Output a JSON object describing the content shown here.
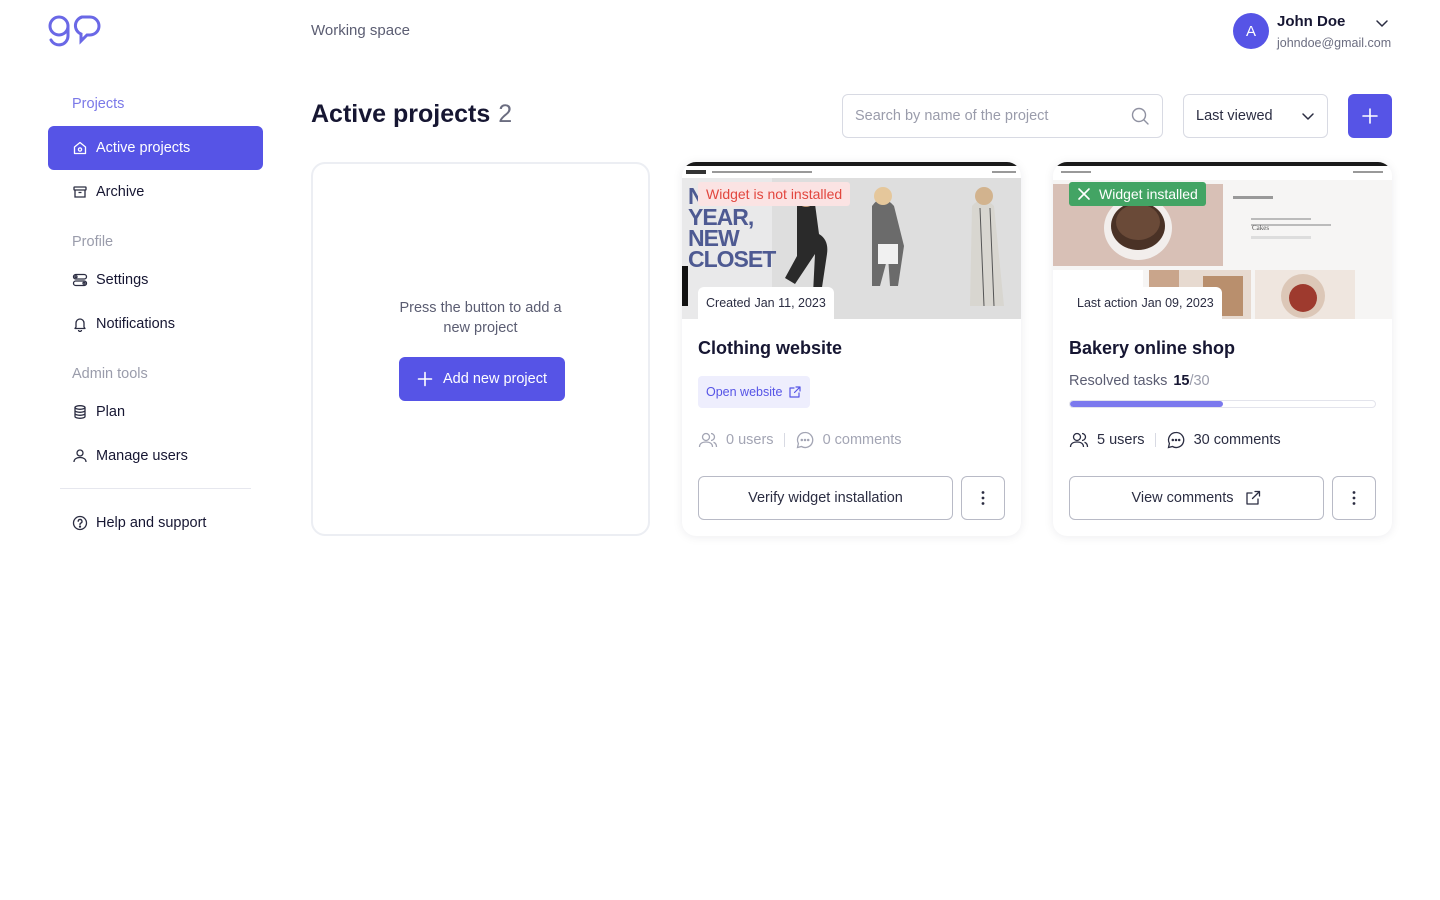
{
  "colors": {
    "accent": "#5654e6",
    "success": "#43a464",
    "danger": "#e2463e"
  },
  "header": {
    "workspace": "Working space",
    "user": {
      "initial": "A",
      "name": "John Doe",
      "email": "johndoe@gmail.com"
    }
  },
  "sidebar": {
    "groups": [
      {
        "label": "Projects",
        "items": [
          {
            "label": "Active projects",
            "icon": "home-icon",
            "active": true
          },
          {
            "label": "Archive",
            "icon": "archive-icon"
          }
        ]
      },
      {
        "label": "Profile",
        "items": [
          {
            "label": "Settings",
            "icon": "settings-icon"
          },
          {
            "label": "Notifications",
            "icon": "bell-icon"
          }
        ]
      },
      {
        "label": "Admin tools",
        "items": [
          {
            "label": "Plan",
            "icon": "database-icon"
          },
          {
            "label": "Manage users",
            "icon": "user-icon"
          }
        ]
      }
    ],
    "help": {
      "label": "Help and support",
      "icon": "help-icon"
    }
  },
  "main": {
    "title": "Active projects",
    "count": "2",
    "search_placeholder": "Search by name of the project",
    "sort_value": "Last viewed",
    "empty_card": {
      "text": "Press the button to add a new project",
      "button": "Add new project"
    },
    "projects": [
      {
        "title": "Clothing website",
        "status": "Widget is not installed",
        "date_label": "Created",
        "date": "Jan 11, 2023",
        "link": "Open website",
        "users": "0 users",
        "comments": "0 comments",
        "action": "Verify widget installation",
        "thumb_text": [
          "N",
          "YEAR,",
          "NEW",
          "CLOSET"
        ]
      },
      {
        "title": "Bakery online shop",
        "status": "Widget installed",
        "date_label": "Last action",
        "date": "Jan 09, 2023",
        "resolved_label": "Resolved tasks",
        "resolved_done": "15",
        "resolved_total": "/30",
        "resolved_fraction": 0.5,
        "users": "5 users",
        "comments": "30 comments",
        "action": "View comments",
        "thumb_text": "Cakes"
      }
    ]
  }
}
